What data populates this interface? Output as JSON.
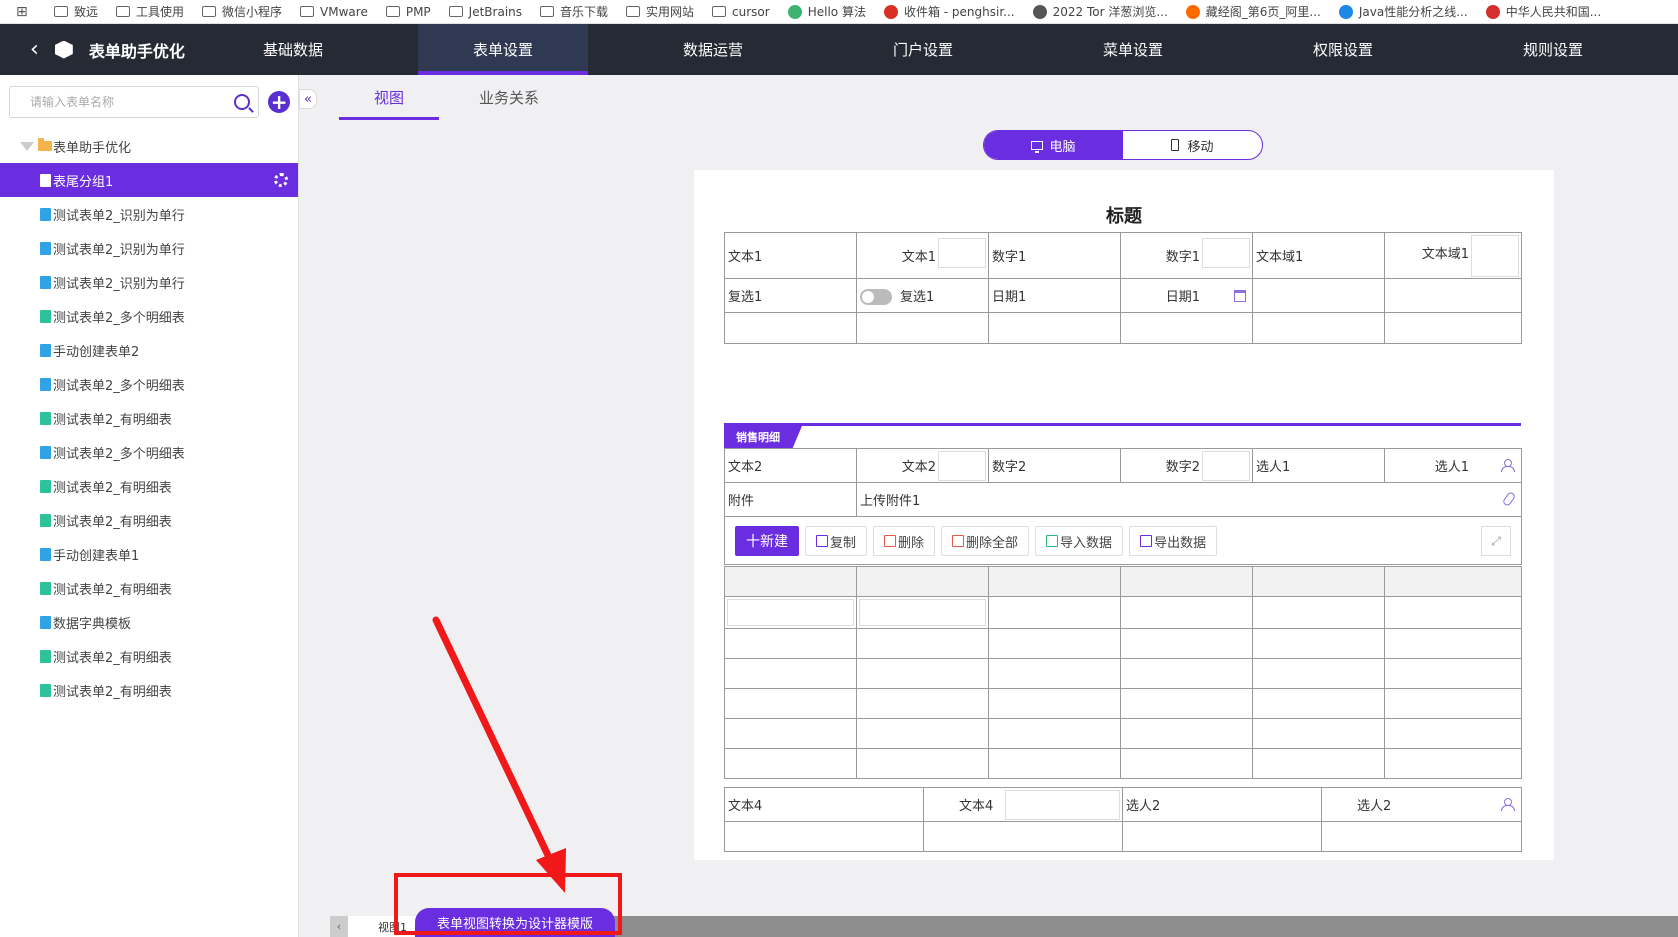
{
  "bookmarks": [
    {
      "label": "致远",
      "icon": "folder-icon"
    },
    {
      "label": "工具使用",
      "icon": "folder-icon"
    },
    {
      "label": "微信小程序",
      "icon": "folder-icon"
    },
    {
      "label": "VMware",
      "icon": "folder-icon"
    },
    {
      "label": "PMP",
      "icon": "folder-icon"
    },
    {
      "label": "JetBrains",
      "icon": "folder-icon"
    },
    {
      "label": "音乐下载",
      "icon": "folder-icon"
    },
    {
      "label": "实用网站",
      "icon": "folder-icon"
    },
    {
      "label": "cursor",
      "icon": "folder-icon"
    },
    {
      "label": "Hello 算法",
      "icon": "chart-icon"
    },
    {
      "label": "收件箱 - penghsir...",
      "icon": "gmail-icon"
    },
    {
      "label": "2022 Tor 洋葱浏览...",
      "icon": "globe-icon"
    },
    {
      "label": "藏经阁_第6页_阿里...",
      "icon": "aliyun-icon"
    },
    {
      "label": "Java性能分析之线...",
      "icon": "blog-icon"
    },
    {
      "label": "中华人民共和国...",
      "icon": "emblem-icon"
    }
  ],
  "topnav": {
    "brand_title": "表单助手优化",
    "tabs": [
      "基础数据",
      "表单设置",
      "数据运营",
      "门户设置",
      "菜单设置",
      "权限设置",
      "规则设置"
    ],
    "active_tab": "表单设置"
  },
  "sidebar": {
    "search_placeholder": "请输入表单名称",
    "root_label": "表单助手优化",
    "selected_label": "表尾分组1",
    "items": [
      {
        "label": "测试表单2_识别为单行",
        "icon": "blue"
      },
      {
        "label": "测试表单2_识别为单行",
        "icon": "blue"
      },
      {
        "label": "测试表单2_识别为单行",
        "icon": "blue"
      },
      {
        "label": "测试表单2_多个明细表",
        "icon": "green"
      },
      {
        "label": "手动创建表单2",
        "icon": "blue"
      },
      {
        "label": "测试表单2_多个明细表",
        "icon": "blue"
      },
      {
        "label": "测试表单2_有明细表",
        "icon": "green"
      },
      {
        "label": "测试表单2_多个明细表",
        "icon": "blue"
      },
      {
        "label": "测试表单2_有明细表",
        "icon": "green"
      },
      {
        "label": "测试表单2_有明细表",
        "icon": "green"
      },
      {
        "label": "手动创建表单1",
        "icon": "blue"
      },
      {
        "label": "测试表单2_有明细表",
        "icon": "green"
      },
      {
        "label": "数据字典模板",
        "icon": "blue"
      },
      {
        "label": "测试表单2_有明细表",
        "icon": "green"
      },
      {
        "label": "测试表单2_有明细表",
        "icon": "green"
      }
    ]
  },
  "subtabs": [
    "视图",
    "业务关系"
  ],
  "device": {
    "desktop": "电脑",
    "mobile": "移动"
  },
  "form": {
    "title": "标题",
    "row1": [
      "文本1",
      "文本1",
      "数字1",
      "数字1",
      "文本域1",
      "文本域1"
    ],
    "row2": [
      "复选1",
      "复选1",
      "日期1",
      "日期1"
    ],
    "section_label": "销售明细",
    "row3": [
      "文本2",
      "文本2",
      "数字2",
      "数字2",
      "选人1",
      "选人1"
    ],
    "attach": [
      "附件",
      "上传附件1"
    ],
    "toolbar": [
      "十新建",
      "复制",
      "删除",
      "删除全部",
      "导入数据",
      "导出数据"
    ],
    "bottom": [
      "文本4",
      "文本4",
      "选人2",
      "选人2"
    ]
  },
  "bottom": {
    "view_tab": "视图1",
    "convert_button": "表单视图转换为设计器模版"
  },
  "colors": {
    "accent": "#6a2de0",
    "nav_bg": "#252a35",
    "annotation": "#f01818"
  }
}
